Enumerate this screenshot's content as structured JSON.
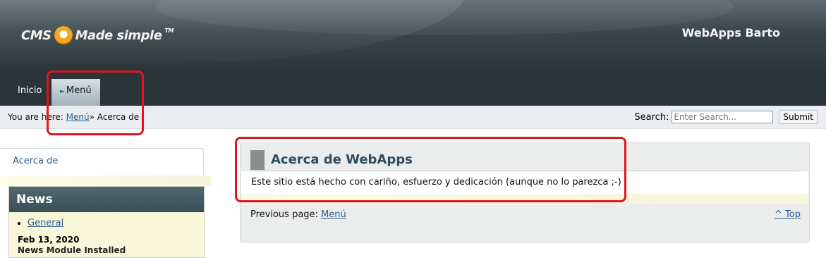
{
  "header": {
    "logo_text": "CMS Made simple",
    "logo_tm": "TM",
    "site_title": "WebApps Barto"
  },
  "nav": {
    "items": [
      {
        "label": "Inicio",
        "active": false
      },
      {
        "label": "Menú",
        "active": true
      }
    ]
  },
  "breadcrumb": {
    "prefix": "You are here:",
    "link": "Menú",
    "separator": "»",
    "current": "Acerca de"
  },
  "search": {
    "label": "Search:",
    "placeholder": "Enter Search...",
    "submit_label": "Submit"
  },
  "sidebar": {
    "link": "Acerca de",
    "news": {
      "title": "News",
      "category": "General",
      "date": "Feb 13, 2020",
      "headline_partial": "News Module Installed"
    }
  },
  "main": {
    "title": "Acerca de WebApps",
    "body": "Este sitio está hecho con cariño, esfuerzo y dedicación (aunque no lo parezca ;-)",
    "prev_label": "Previous page:",
    "prev_link": "Menú",
    "top_link": "^ Top"
  },
  "colors": {
    "highlight": "#e3141d",
    "link": "#2a5d8c",
    "nav_bg": "#2a3439",
    "title": "#2f4d5f"
  }
}
